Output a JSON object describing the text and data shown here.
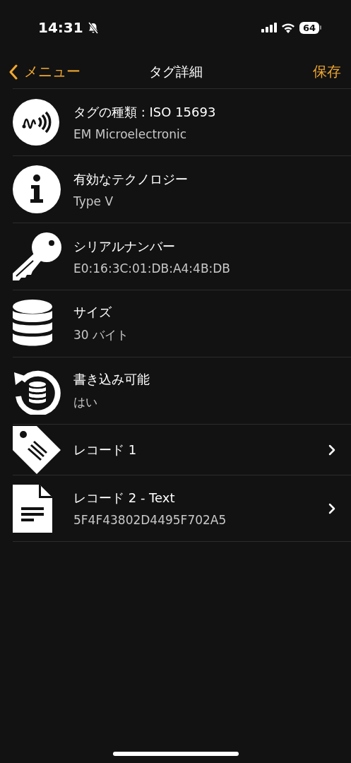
{
  "status_bar": {
    "time": "14:31",
    "battery": "64"
  },
  "nav": {
    "back": "メニュー",
    "title": "タグ詳細",
    "action": "保存"
  },
  "rows": [
    {
      "kind": "wave",
      "title": "タグの種類 : ISO 15693",
      "subtitle": "EM Microelectronic",
      "navigable": false
    },
    {
      "kind": "info",
      "title": "有効なテクノロジー",
      "subtitle": "Type V",
      "navigable": false
    },
    {
      "kind": "key",
      "title": "シリアルナンバー",
      "subtitle": "E0:16:3C:01:DB:A4:4B:DB",
      "navigable": false
    },
    {
      "kind": "database",
      "title": "サイズ",
      "subtitle": "30 バイト",
      "navigable": false
    },
    {
      "kind": "rewrite",
      "title": "書き込み可能",
      "subtitle": "はい",
      "navigable": false
    },
    {
      "kind": "tag",
      "title": "レコード 1",
      "navigable": true
    },
    {
      "kind": "document",
      "title": "レコード 2 - Text",
      "subtitle": "5F4F43802D4495F702A5",
      "navigable": true
    }
  ]
}
